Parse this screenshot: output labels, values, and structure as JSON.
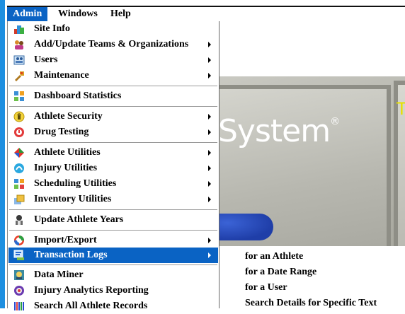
{
  "menubar": {
    "items": [
      {
        "label": "Admin",
        "active": true
      },
      {
        "label": "Windows"
      },
      {
        "label": "Help"
      }
    ]
  },
  "hero": {
    "logo_text": "System",
    "logo_mark": "®",
    "yellow_text": "T"
  },
  "admin_menu": {
    "items": [
      {
        "label": "Site Info",
        "icon": "site-info-icon",
        "submenu": false
      },
      {
        "label": "Add/Update Teams & Organizations",
        "icon": "teams-icon",
        "submenu": true
      },
      {
        "label": "Users",
        "icon": "users-icon",
        "submenu": true
      },
      {
        "label": "Maintenance",
        "icon": "maintenance-icon",
        "submenu": true
      },
      {
        "label": "Dashboard Statistics",
        "icon": "dashboard-icon",
        "submenu": false
      },
      {
        "label": "Athlete Security",
        "icon": "security-icon",
        "submenu": true
      },
      {
        "label": "Drug Testing",
        "icon": "drug-testing-icon",
        "submenu": true
      },
      {
        "label": "Athlete Utilities",
        "icon": "athlete-utilities-icon",
        "submenu": true
      },
      {
        "label": "Injury Utilities",
        "icon": "injury-utilities-icon",
        "submenu": true
      },
      {
        "label": "Scheduling Utilities",
        "icon": "scheduling-icon",
        "submenu": true
      },
      {
        "label": "Inventory Utilities",
        "icon": "inventory-icon",
        "submenu": true
      },
      {
        "label": "Update Athlete Years",
        "icon": "athlete-years-icon",
        "submenu": false
      },
      {
        "label": "Import/Export",
        "icon": "import-export-icon",
        "submenu": true
      },
      {
        "label": "Transaction Logs",
        "icon": "transaction-logs-icon",
        "submenu": true,
        "active": true
      },
      {
        "label": "Data Miner",
        "icon": "data-miner-icon",
        "submenu": false
      },
      {
        "label": "Injury Analytics Reporting",
        "icon": "analytics-icon",
        "submenu": false
      },
      {
        "label": "Search All Athlete Records",
        "icon": "search-records-icon",
        "submenu": false
      }
    ]
  },
  "transaction_logs_submenu": {
    "items": [
      {
        "label": "for an Athlete"
      },
      {
        "label": "for a Date Range"
      },
      {
        "label": "for a User"
      },
      {
        "label": "Search Details for Specific Text"
      }
    ]
  },
  "colors": {
    "accent": "#0a63c4",
    "left_strip": "#1e8fe0",
    "highlight_text": "#ffffff"
  }
}
